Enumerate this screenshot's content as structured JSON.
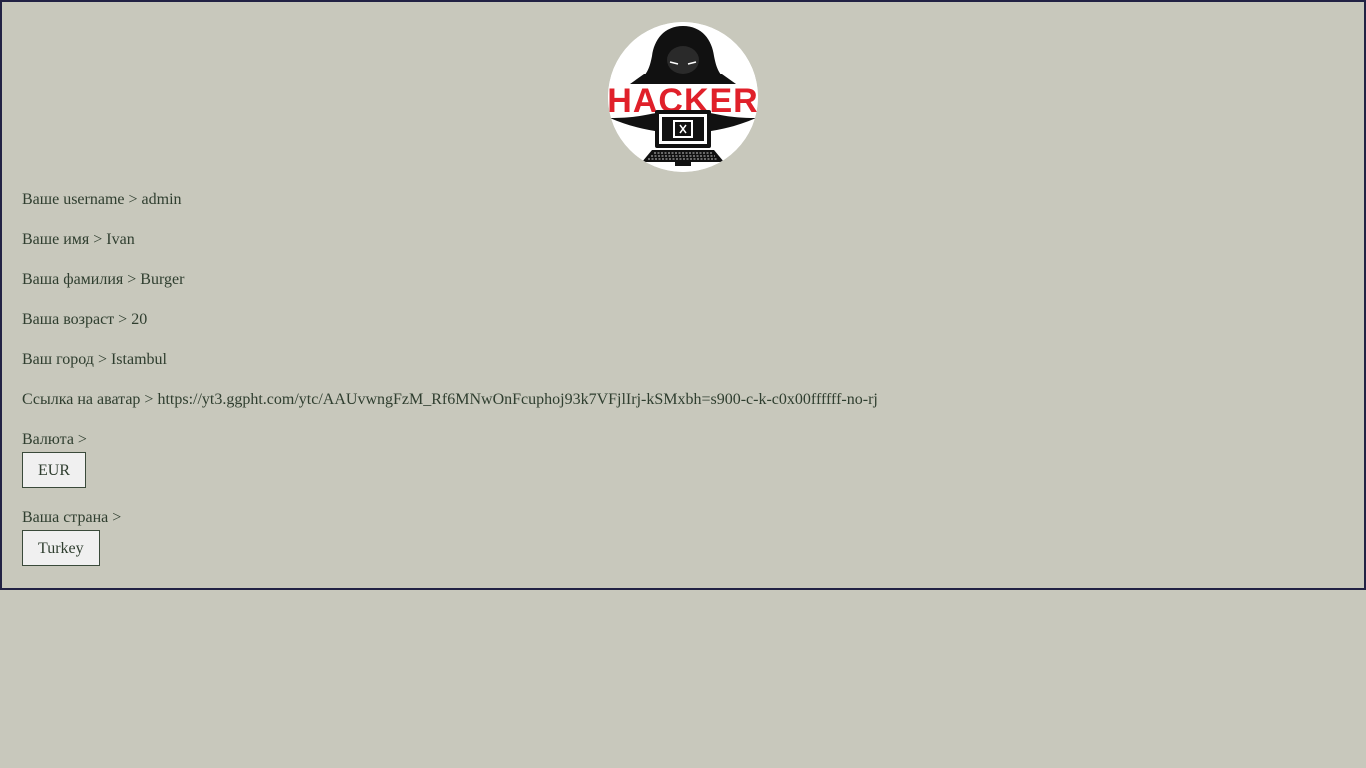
{
  "avatar": {
    "logo_text": "HACKER"
  },
  "fields": {
    "username": {
      "label": "Ваше username >",
      "value": "admin"
    },
    "first_name": {
      "label": "Ваше имя >",
      "value": "Ivan"
    },
    "last_name": {
      "label": "Ваша фамилия >",
      "value": "Burger"
    },
    "age": {
      "label": "Ваша возраст >",
      "value": "20"
    },
    "city": {
      "label": "Ваш город >",
      "value": "Istambul"
    },
    "avatar_link": {
      "label": "Ссылка на аватар >",
      "value": "https://yt3.ggpht.com/ytc/AAUvwngFzM_Rf6MNwOnFcuphoj93k7VFjlIrj-kSMxbh=s900-c-k-c0x00ffffff-no-rj"
    },
    "currency": {
      "label": "Валюта >",
      "value": "EUR"
    },
    "country": {
      "label": "Ваша страна >",
      "value": "Turkey"
    }
  },
  "colors": {
    "background": "#c8c8bc",
    "border": "#222244",
    "text": "#2f3e2f",
    "logo_red": "#e0202a"
  }
}
